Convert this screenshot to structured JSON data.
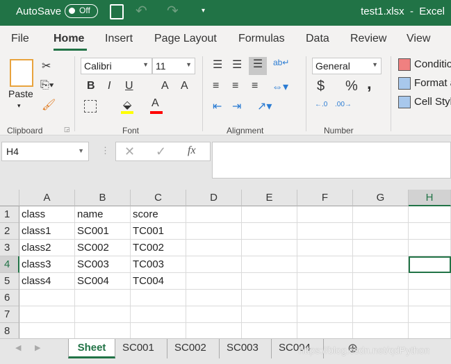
{
  "titlebar": {
    "autosave_label": "AutoSave",
    "autosave_state": "Off",
    "title": "test1.xlsx  -  Excel",
    "bg": "#217346"
  },
  "tabs": [
    {
      "label": "File"
    },
    {
      "label": "Home",
      "active": true
    },
    {
      "label": "Insert"
    },
    {
      "label": "Page Layout"
    },
    {
      "label": "Formulas"
    },
    {
      "label": "Data"
    },
    {
      "label": "Review"
    },
    {
      "label": "View"
    }
  ],
  "ribbon": {
    "clipboard": {
      "label": "Clipboard",
      "paste": "Paste"
    },
    "font": {
      "label": "Font",
      "name": "Calibri",
      "size": "11",
      "bold": "B",
      "italic": "I",
      "underline": "U",
      "grow": "A",
      "shrink": "A",
      "color_letter": "A",
      "highlight_color": "#ffff00",
      "font_color": "#ff0000"
    },
    "alignment": {
      "label": "Alignment"
    },
    "number": {
      "label": "Number",
      "format": "General",
      "currency": "$",
      "percent": "%",
      "comma": ","
    },
    "styles": {
      "conditional": "Conditio",
      "format_as": "Format a",
      "cell_styles": "Cell Styl"
    }
  },
  "formula_bar": {
    "name_box": "H4",
    "fx": "fx",
    "value": ""
  },
  "grid": {
    "columns": [
      "A",
      "B",
      "C",
      "D",
      "E",
      "F",
      "G",
      "H"
    ],
    "rows": [
      [
        "class",
        "name",
        "score"
      ],
      [
        "class1",
        "SC001",
        "TC001"
      ],
      [
        "class2",
        "SC002",
        "TC002"
      ],
      [
        "class3",
        "SC003",
        "TC003"
      ],
      [
        "class4",
        "SC004",
        "TC004"
      ],
      [],
      [],
      []
    ],
    "active_cell": "H4"
  },
  "sheets": [
    {
      "label": "Sheet",
      "active": true
    },
    {
      "label": "SC001"
    },
    {
      "label": "SC002"
    },
    {
      "label": "SC003"
    },
    {
      "label": "SC004"
    }
  ],
  "watermark": "https://blog.csdn.net/qdPython"
}
